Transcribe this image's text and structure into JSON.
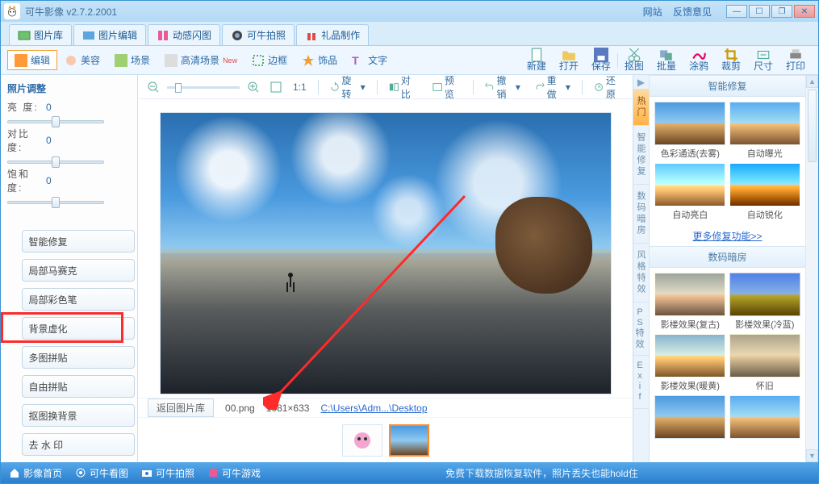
{
  "app": {
    "title": "可牛影像  v2.7.2.2001",
    "site_link": "网站",
    "feedback_link": "反馈意见"
  },
  "main_tabs": [
    {
      "label": "图片库"
    },
    {
      "label": "图片编辑"
    },
    {
      "label": "动感闪图"
    },
    {
      "label": "可牛拍照"
    },
    {
      "label": "礼品制作"
    }
  ],
  "edit_tabs": [
    {
      "label": "编辑"
    },
    {
      "label": "美容"
    },
    {
      "label": "场景"
    },
    {
      "label": "高清场景",
      "badge": "New"
    },
    {
      "label": "边框"
    },
    {
      "label": "饰品"
    },
    {
      "label": "文字"
    }
  ],
  "ops": [
    {
      "label": "新建"
    },
    {
      "label": "打开"
    },
    {
      "label": "保存"
    },
    {
      "label": "抠图"
    },
    {
      "label": "批量"
    },
    {
      "label": "涂鸦"
    },
    {
      "label": "裁剪"
    },
    {
      "label": "尺寸"
    },
    {
      "label": "打印"
    }
  ],
  "adjust": {
    "title": "照片调整",
    "brightness_label": "亮  度:",
    "brightness_val": "0",
    "contrast_label": "对比度:",
    "contrast_val": "0",
    "saturation_label": "饱和度:",
    "saturation_val": "0"
  },
  "side_tools": [
    {
      "label": "智能修复"
    },
    {
      "label": "局部马赛克"
    },
    {
      "label": "局部彩色笔"
    },
    {
      "label": "背景虚化"
    },
    {
      "label": "多图拼贴"
    },
    {
      "label": "自由拼贴"
    },
    {
      "label": "抠图换背景"
    },
    {
      "label": "去 水 印"
    }
  ],
  "canvas_bar": {
    "ratio": "1:1",
    "rotate": "旋转",
    "compare": "对比",
    "preview": "预览",
    "undo": "撤销",
    "redo": "重做",
    "restore": "还原"
  },
  "info": {
    "back": "返回图片库",
    "filename": "00.png",
    "dims": "1081×633",
    "path": "C:\\Users\\Adm...\\Desktop"
  },
  "right": {
    "tabs": [
      "热门",
      "智能修复",
      "数码暗房",
      "风格特效",
      "PS特效",
      "Exif"
    ],
    "section1": "智能修复",
    "items1": [
      "色彩通透(去雾)",
      "自动曝光",
      "自动亮白",
      "自动锐化"
    ],
    "more": "更多修复功能>>",
    "section2": "数码暗房",
    "items2": [
      "影楼效果(复古)",
      "影楼效果(冷蓝)",
      "影楼效果(暖黄)",
      "怀旧"
    ]
  },
  "status": {
    "home": "影像首页",
    "view": "可牛看图",
    "camera": "可牛拍照",
    "game": "可牛游戏",
    "center": "免费下载数据恢复软件，照片丢失也能hold住"
  }
}
